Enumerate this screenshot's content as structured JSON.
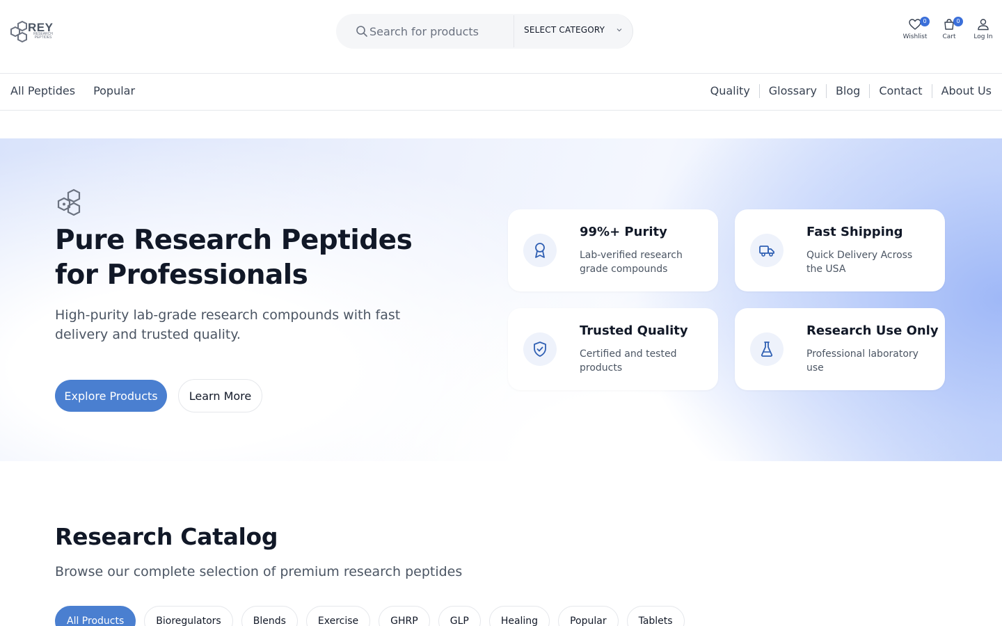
{
  "brand": {
    "name": "REY",
    "subtitle_line1": "RESEARCH",
    "subtitle_line2": "PEPTIDES"
  },
  "header": {
    "search_placeholder": "Search for products",
    "category_label": "SELECT CATEGORY",
    "wishlist": {
      "label": "Wishlist",
      "count": "0"
    },
    "cart": {
      "label": "Cart",
      "count": "0"
    },
    "login": {
      "label": "Log In"
    }
  },
  "nav": {
    "left": [
      "All Peptides",
      "Popular"
    ],
    "right": [
      "Quality",
      "Glossary",
      "Blog",
      "Contact",
      "About Us"
    ]
  },
  "hero": {
    "title": "Pure Research Peptides for Professionals",
    "subtitle": "High-purity lab-grade research compounds with fast delivery and trusted quality.",
    "primary_button": "Explore Products",
    "secondary_button": "Learn More",
    "features": [
      {
        "icon": "award-icon",
        "title": "99%+ Purity",
        "desc": "Lab-verified research grade compounds"
      },
      {
        "icon": "truck-icon",
        "title": "Fast Shipping",
        "desc": "Quick Delivery Across the USA"
      },
      {
        "icon": "shield-check-icon",
        "title": "Trusted Quality",
        "desc": "Certified and tested products"
      },
      {
        "icon": "flask-icon",
        "title": "Research Use Only",
        "desc": "Professional laboratory use"
      }
    ]
  },
  "catalog": {
    "title": "Research Catalog",
    "subtitle": "Browse our complete selection of premium research peptides",
    "filters": [
      "All Products",
      "Bioregulators",
      "Blends",
      "Exercise",
      "GHRP",
      "GLP",
      "Healing",
      "Popular",
      "Tablets"
    ],
    "active_filter": "All Products"
  },
  "colors": {
    "accent": "#4a7fd0",
    "badge": "#3b6fd9",
    "icon_blue": "#2f5fb3"
  }
}
